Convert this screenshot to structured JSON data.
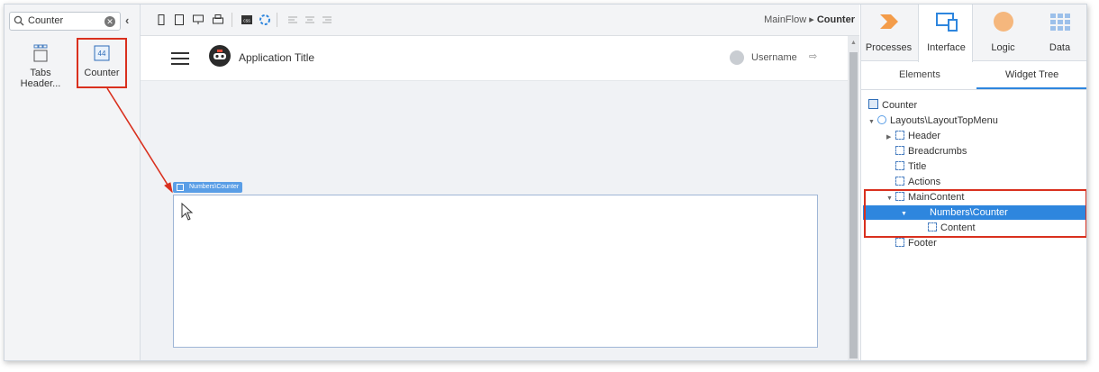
{
  "search": {
    "value": "Counter"
  },
  "toolbox": {
    "items": [
      {
        "label": "Tabs Header..."
      },
      {
        "label": "Counter"
      }
    ]
  },
  "breadcrumb": {
    "flow": "MainFlow",
    "separator": "▸",
    "screen": "Counter"
  },
  "app": {
    "title": "Application Title",
    "username": "Username"
  },
  "canvas": {
    "widget_tag": "Numbers\\Counter"
  },
  "tabs": [
    {
      "label": "Processes",
      "color": "#f39c4a"
    },
    {
      "label": "Interface",
      "color": "#2e86de"
    },
    {
      "label": "Logic",
      "color": "#f5b77d"
    },
    {
      "label": "Data",
      "color": "#9cc0ea"
    }
  ],
  "subtabs": {
    "elements": "Elements",
    "widget_tree": "Widget Tree"
  },
  "tree": [
    {
      "label": "Counter"
    },
    {
      "label": "Layouts\\LayoutTopMenu"
    },
    {
      "label": "Header"
    },
    {
      "label": "Breadcrumbs"
    },
    {
      "label": "Title"
    },
    {
      "label": "Actions"
    },
    {
      "label": "MainContent"
    },
    {
      "label": "Numbers\\Counter"
    },
    {
      "label": "Content"
    },
    {
      "label": "Footer"
    }
  ],
  "colors": {
    "accent": "#2e86de",
    "highlight": "#d9301e"
  }
}
